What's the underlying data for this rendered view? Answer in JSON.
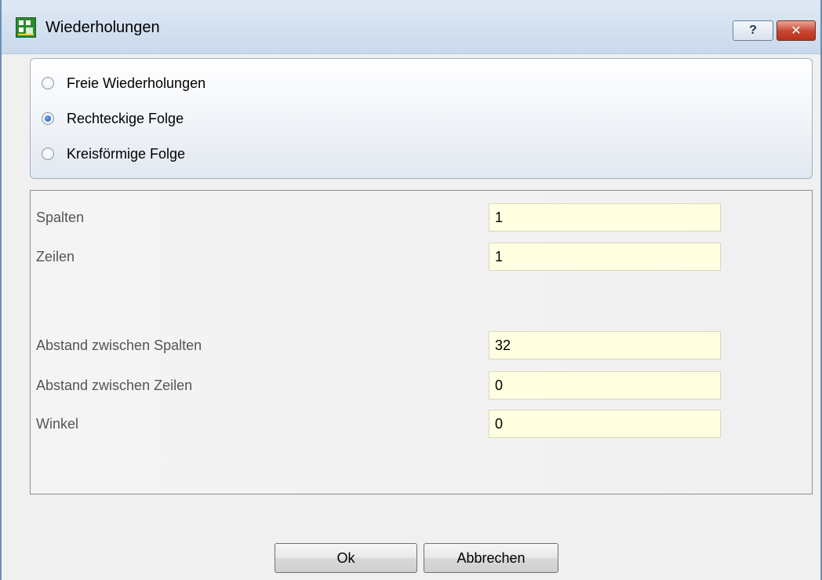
{
  "window": {
    "title": "Wiederholungen",
    "help_label": "?",
    "close_label": "✕"
  },
  "repeat_mode": {
    "options": [
      {
        "label": "Freie Wiederholungen",
        "checked": false
      },
      {
        "label": "Rechteckige Folge",
        "checked": true
      },
      {
        "label": "Kreisförmige Folge",
        "checked": false
      }
    ]
  },
  "params": {
    "columns": {
      "label": "Spalten",
      "value": "1"
    },
    "rows": {
      "label": "Zeilen",
      "value": "1"
    },
    "column_spacing": {
      "label": "Abstand zwischen Spalten",
      "value": "32"
    },
    "row_spacing": {
      "label": "Abstand zwischen Zeilen",
      "value": "0"
    },
    "angle": {
      "label": "Winkel",
      "value": "0"
    }
  },
  "buttons": {
    "ok_label": "Ok",
    "cancel_label": "Abbrechen"
  },
  "colors": {
    "input_background": "#ffffe1",
    "close_button": "#c64430",
    "app_icon": "#2b8a2b"
  }
}
